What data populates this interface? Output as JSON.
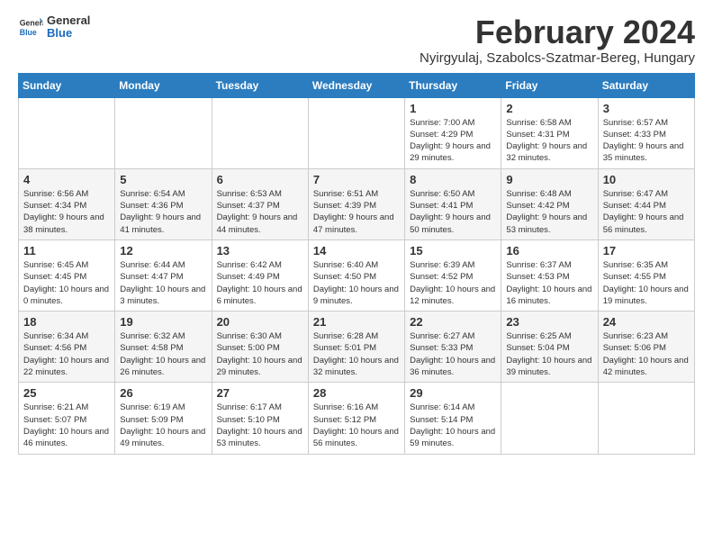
{
  "logo": {
    "general": "General",
    "blue": "Blue"
  },
  "header": {
    "title": "February 2024",
    "subtitle": "Nyirgyulaj, Szabolcs-Szatmar-Bereg, Hungary"
  },
  "calendar": {
    "days_of_week": [
      "Sunday",
      "Monday",
      "Tuesday",
      "Wednesday",
      "Thursday",
      "Friday",
      "Saturday"
    ],
    "weeks": [
      [
        {
          "day": "",
          "info": ""
        },
        {
          "day": "",
          "info": ""
        },
        {
          "day": "",
          "info": ""
        },
        {
          "day": "",
          "info": ""
        },
        {
          "day": "1",
          "info": "Sunrise: 7:00 AM\nSunset: 4:29 PM\nDaylight: 9 hours\nand 29 minutes."
        },
        {
          "day": "2",
          "info": "Sunrise: 6:58 AM\nSunset: 4:31 PM\nDaylight: 9 hours\nand 32 minutes."
        },
        {
          "day": "3",
          "info": "Sunrise: 6:57 AM\nSunset: 4:33 PM\nDaylight: 9 hours\nand 35 minutes."
        }
      ],
      [
        {
          "day": "4",
          "info": "Sunrise: 6:56 AM\nSunset: 4:34 PM\nDaylight: 9 hours\nand 38 minutes."
        },
        {
          "day": "5",
          "info": "Sunrise: 6:54 AM\nSunset: 4:36 PM\nDaylight: 9 hours\nand 41 minutes."
        },
        {
          "day": "6",
          "info": "Sunrise: 6:53 AM\nSunset: 4:37 PM\nDaylight: 9 hours\nand 44 minutes."
        },
        {
          "day": "7",
          "info": "Sunrise: 6:51 AM\nSunset: 4:39 PM\nDaylight: 9 hours\nand 47 minutes."
        },
        {
          "day": "8",
          "info": "Sunrise: 6:50 AM\nSunset: 4:41 PM\nDaylight: 9 hours\nand 50 minutes."
        },
        {
          "day": "9",
          "info": "Sunrise: 6:48 AM\nSunset: 4:42 PM\nDaylight: 9 hours\nand 53 minutes."
        },
        {
          "day": "10",
          "info": "Sunrise: 6:47 AM\nSunset: 4:44 PM\nDaylight: 9 hours\nand 56 minutes."
        }
      ],
      [
        {
          "day": "11",
          "info": "Sunrise: 6:45 AM\nSunset: 4:45 PM\nDaylight: 10 hours\nand 0 minutes."
        },
        {
          "day": "12",
          "info": "Sunrise: 6:44 AM\nSunset: 4:47 PM\nDaylight: 10 hours\nand 3 minutes."
        },
        {
          "day": "13",
          "info": "Sunrise: 6:42 AM\nSunset: 4:49 PM\nDaylight: 10 hours\nand 6 minutes."
        },
        {
          "day": "14",
          "info": "Sunrise: 6:40 AM\nSunset: 4:50 PM\nDaylight: 10 hours\nand 9 minutes."
        },
        {
          "day": "15",
          "info": "Sunrise: 6:39 AM\nSunset: 4:52 PM\nDaylight: 10 hours\nand 12 minutes."
        },
        {
          "day": "16",
          "info": "Sunrise: 6:37 AM\nSunset: 4:53 PM\nDaylight: 10 hours\nand 16 minutes."
        },
        {
          "day": "17",
          "info": "Sunrise: 6:35 AM\nSunset: 4:55 PM\nDaylight: 10 hours\nand 19 minutes."
        }
      ],
      [
        {
          "day": "18",
          "info": "Sunrise: 6:34 AM\nSunset: 4:56 PM\nDaylight: 10 hours\nand 22 minutes."
        },
        {
          "day": "19",
          "info": "Sunrise: 6:32 AM\nSunset: 4:58 PM\nDaylight: 10 hours\nand 26 minutes."
        },
        {
          "day": "20",
          "info": "Sunrise: 6:30 AM\nSunset: 5:00 PM\nDaylight: 10 hours\nand 29 minutes."
        },
        {
          "day": "21",
          "info": "Sunrise: 6:28 AM\nSunset: 5:01 PM\nDaylight: 10 hours\nand 32 minutes."
        },
        {
          "day": "22",
          "info": "Sunrise: 6:27 AM\nSunset: 5:33 PM\nDaylight: 10 hours\nand 36 minutes."
        },
        {
          "day": "23",
          "info": "Sunrise: 6:25 AM\nSunset: 5:04 PM\nDaylight: 10 hours\nand 39 minutes."
        },
        {
          "day": "24",
          "info": "Sunrise: 6:23 AM\nSunset: 5:06 PM\nDaylight: 10 hours\nand 42 minutes."
        }
      ],
      [
        {
          "day": "25",
          "info": "Sunrise: 6:21 AM\nSunset: 5:07 PM\nDaylight: 10 hours\nand 46 minutes."
        },
        {
          "day": "26",
          "info": "Sunrise: 6:19 AM\nSunset: 5:09 PM\nDaylight: 10 hours\nand 49 minutes."
        },
        {
          "day": "27",
          "info": "Sunrise: 6:17 AM\nSunset: 5:10 PM\nDaylight: 10 hours\nand 53 minutes."
        },
        {
          "day": "28",
          "info": "Sunrise: 6:16 AM\nSunset: 5:12 PM\nDaylight: 10 hours\nand 56 minutes."
        },
        {
          "day": "29",
          "info": "Sunrise: 6:14 AM\nSunset: 5:14 PM\nDaylight: 10 hours\nand 59 minutes."
        },
        {
          "day": "",
          "info": ""
        },
        {
          "day": "",
          "info": ""
        }
      ]
    ]
  }
}
